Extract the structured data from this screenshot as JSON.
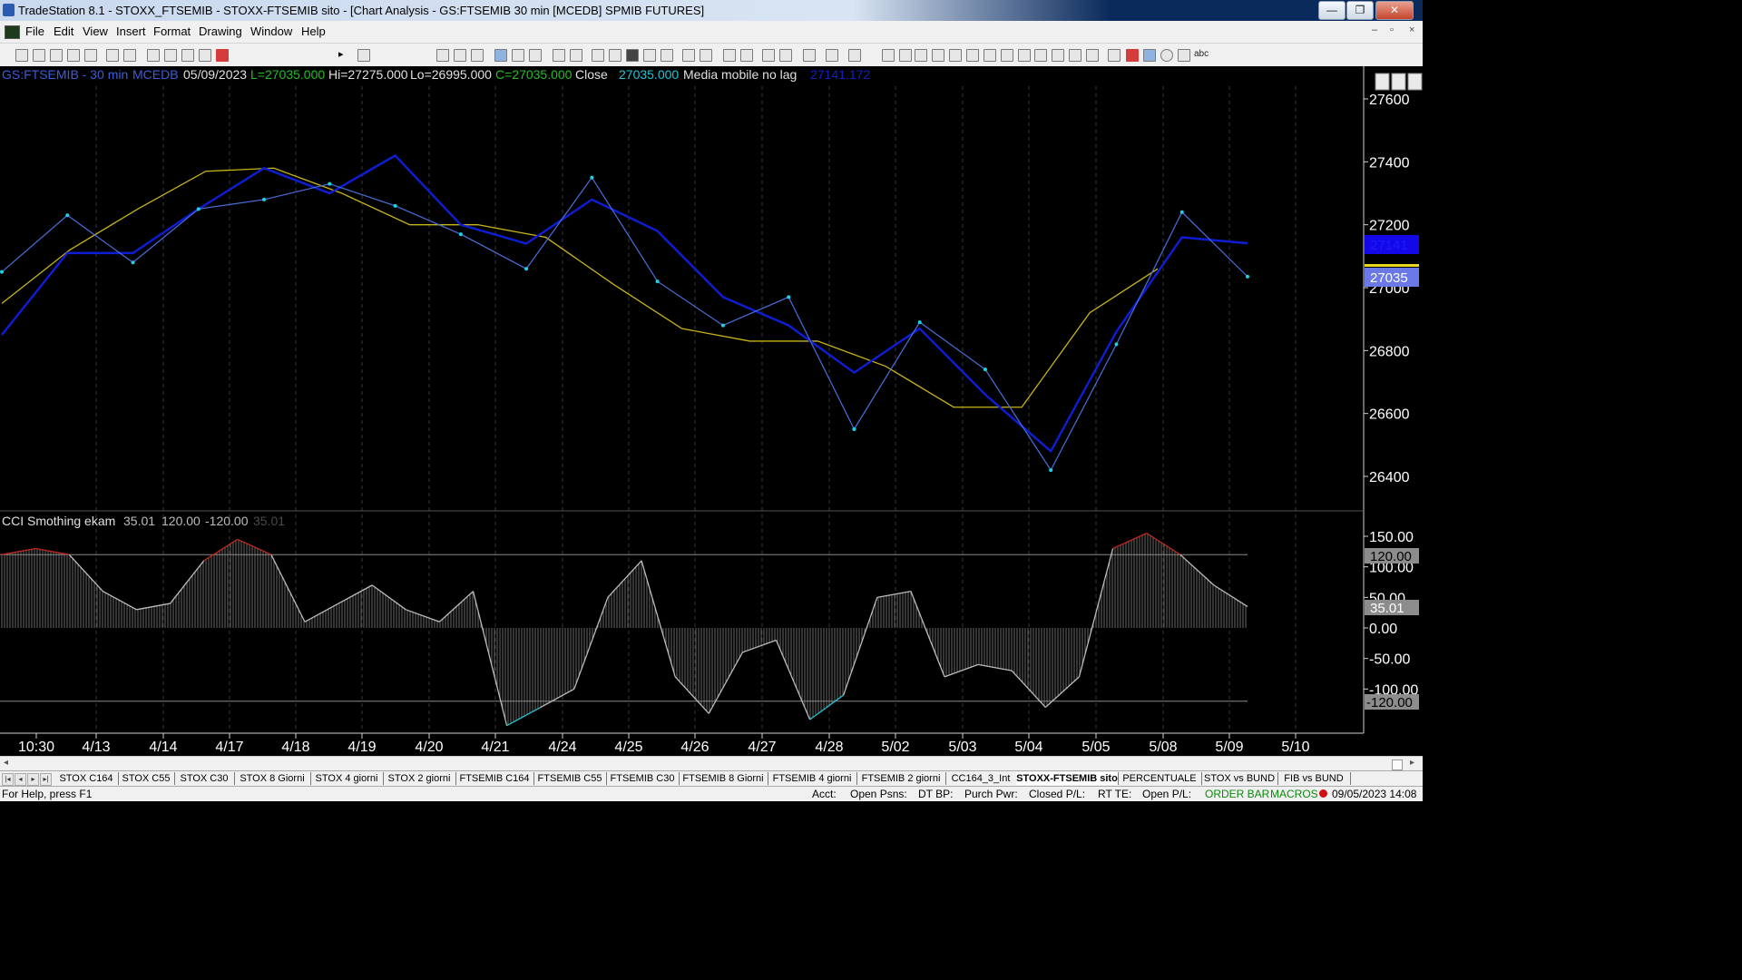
{
  "window": {
    "title": "TradeStation 8.1 - STOXX_FTSEMIB - STOXX-FTSEMIB sito - [Chart Analysis - GS:FTSEMIB  30 min  [MCEDB] SPMIB FUTURES]",
    "minimize_glyph": "—",
    "restore_glyph": "❐",
    "close_glyph": "✕"
  },
  "menu": {
    "items": [
      "File",
      "Edit",
      "View",
      "Insert",
      "Format",
      "Drawing",
      "Window",
      "Help"
    ],
    "mdi_controls": [
      "–",
      "▫",
      "×"
    ]
  },
  "toolbar": {
    "combo_value": "",
    "combo_arrow": "▾",
    "play_arrow": "▸",
    "text_tool_label": "abc"
  },
  "chart": {
    "symbol": "GS:FTSEMIB - 30 min",
    "datafeed": "MCEDB",
    "date": "05/09/2023",
    "last": "L=27035.000",
    "high": "Hi=27275.000",
    "low": "Lo=26995.000",
    "close_text": "C=27035.000",
    "close_label": "Close",
    "close_value": "27035.000",
    "ma_label": "Media mobile no lag",
    "ma_value": "27141.172",
    "price_axis_ticks": [
      "27600",
      "27400",
      "27200",
      "27000",
      "26800",
      "26600",
      "26400"
    ],
    "last_price_tag": "27035",
    "ma_price_tag": "27141",
    "colors": {
      "price_line": "#4a6fdc",
      "price_dots": "#19d3e6",
      "fast_ma": "#0d1ed6",
      "slow_ma": "#c8b41a",
      "cci_line": "#bcbcbc",
      "cci_overbought": "#c0281e",
      "cci_oversold": "#21c4d4",
      "header_cyan": "#20c8d8",
      "header_green": "#20c020"
    }
  },
  "indicator": {
    "name": "CCI Smothing ekam",
    "value1": "35.01",
    "upper": "120.00",
    "lower": "-120.00",
    "value2": "35.01",
    "axis_ticks": [
      "150.00",
      "100.00",
      "50.00",
      "0.00",
      "-50.00",
      "-100.00"
    ],
    "upper_tag": "120.00",
    "lower_tag": "-120.00",
    "current_tag": "35.01"
  },
  "time_axis": [
    "10:30",
    "4/13",
    "4/14",
    "4/17",
    "4/18",
    "4/19",
    "4/20",
    "4/21",
    "4/24",
    "4/25",
    "4/26",
    "4/27",
    "4/28",
    "5/02",
    "5/03",
    "5/04",
    "5/05",
    "5/08",
    "5/09",
    "5/10"
  ],
  "sheet_tabs": [
    "STOX C164",
    "STOX C55",
    "STOX  C30",
    "STOX  8 Giorni",
    "STOX 4 giorni",
    "STOX  2 giorni",
    "FTSEMIB C164",
    "FTSEMIB C55",
    "FTSEMIB C30",
    "FTSEMIB  8 Giorni",
    "FTSEMIB  4 giorni",
    "FTSEMIB  2 giorni",
    "CC164_3_Int",
    "STOXX-FTSEMIB sito",
    "PERCENTUALE",
    "STOX vs BUND",
    "FIB vs BUND"
  ],
  "active_tab": "STOXX-FTSEMIB sito",
  "status": {
    "help": "For Help, press F1",
    "acct": "Acct:",
    "open_psns": "Open Psns:",
    "dt_bp": "DT BP:",
    "purch_pwr": "Purch Pwr:",
    "closed_pl": "Closed P/L:",
    "rt_te": "RT TE:",
    "open_pl": "Open P/L:",
    "order_bar": "ORDER BAR",
    "macros": "MACROS",
    "datetime": "09/05/2023 14:08"
  },
  "chart_data": [
    {
      "type": "line",
      "title": "GS:FTSEMIB - 30 min",
      "x": [
        "10:30",
        "4/13",
        "4/14",
        "4/17",
        "4/18",
        "4/19",
        "4/20",
        "4/21",
        "4/24",
        "4/25",
        "4/26",
        "4/27",
        "4/28",
        "5/02",
        "5/03",
        "5/04",
        "5/05",
        "5/08",
        "5/09"
      ],
      "ylim": [
        26300,
        27700
      ],
      "series": [
        {
          "name": "Close",
          "values": [
            27050,
            27230,
            27080,
            27250,
            27280,
            27330,
            27260,
            27170,
            27060,
            27350,
            27020,
            26880,
            26970,
            26550,
            26890,
            26740,
            26420,
            26820,
            27240,
            27035
          ]
        },
        {
          "name": "Media mobile no lag",
          "values": [
            26850,
            27110,
            27110,
            27250,
            27380,
            27300,
            27420,
            27200,
            27140,
            27280,
            27180,
            26970,
            26880,
            26730,
            26870,
            26660,
            26480,
            26860,
            27160,
            27141
          ]
        },
        {
          "name": "",
          "values": [
            26950,
            27120,
            27250,
            27370,
            27380,
            27300,
            27200,
            27200,
            27160,
            27010,
            26870,
            26830,
            26830,
            26750,
            26620,
            26620,
            26920,
            27060
          ]
        }
      ]
    },
    {
      "type": "area",
      "title": "CCI Smothing ekam",
      "ylim": [
        -170,
        160
      ],
      "reference_lines": [
        120,
        -120
      ],
      "series": [
        {
          "name": "CCI Smothing ekam",
          "values": [
            120,
            130,
            120,
            60,
            30,
            40,
            110,
            145,
            120,
            10,
            40,
            70,
            30,
            10,
            60,
            -160,
            -130,
            -100,
            50,
            110,
            -80,
            -140,
            -40,
            -20,
            -150,
            -110,
            50,
            60,
            -80,
            -60,
            -70,
            -130,
            -80,
            130,
            155,
            120,
            70,
            35
          ]
        }
      ]
    }
  ]
}
